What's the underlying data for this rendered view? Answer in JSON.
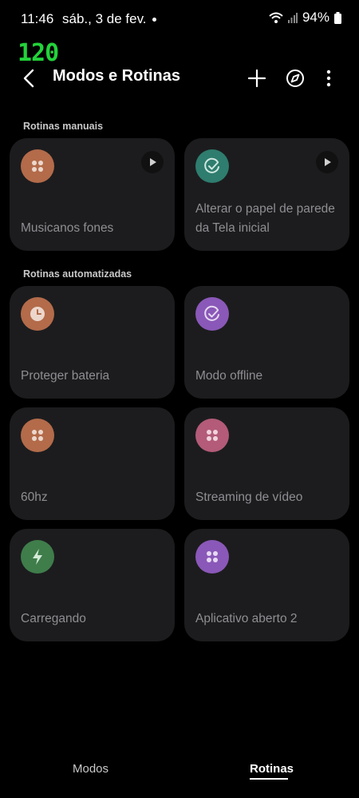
{
  "status": {
    "time": "11:46",
    "date": "sáb., 3 de fev.",
    "battery": "94%",
    "fps": "120"
  },
  "header": {
    "title": "Modos e Rotinas"
  },
  "sections": {
    "manual": "Rotinas manuais",
    "automated": "Rotinas automatizadas"
  },
  "manual_routines": [
    {
      "label": "Musicanos fones",
      "icon": "grid-dots-icon",
      "color": "#b36b4a"
    },
    {
      "label": "Alterar o papel de parede da Tela inicial",
      "icon": "check-circle-icon",
      "color": "#2e7d6e"
    }
  ],
  "automated_routines": [
    {
      "label": "Proteger bateria",
      "icon": "clock-icon",
      "color": "#b36b4a"
    },
    {
      "label": "Modo offline",
      "icon": "check-circle-icon",
      "color": "#8a58b8"
    },
    {
      "label": "60hz",
      "icon": "grid-dots-icon",
      "color": "#b36b4a"
    },
    {
      "label": "Streaming de vídeo",
      "icon": "grid-dots-icon",
      "color": "#b35b78"
    },
    {
      "label": "Carregando",
      "icon": "bolt-icon",
      "color": "#3f7d4b"
    },
    {
      "label": "Aplicativo aberto 2",
      "icon": "grid-dots-icon",
      "color": "#8a58b8"
    }
  ],
  "bottom_nav": {
    "modes": "Modos",
    "routines": "Rotinas",
    "active": "routines"
  }
}
